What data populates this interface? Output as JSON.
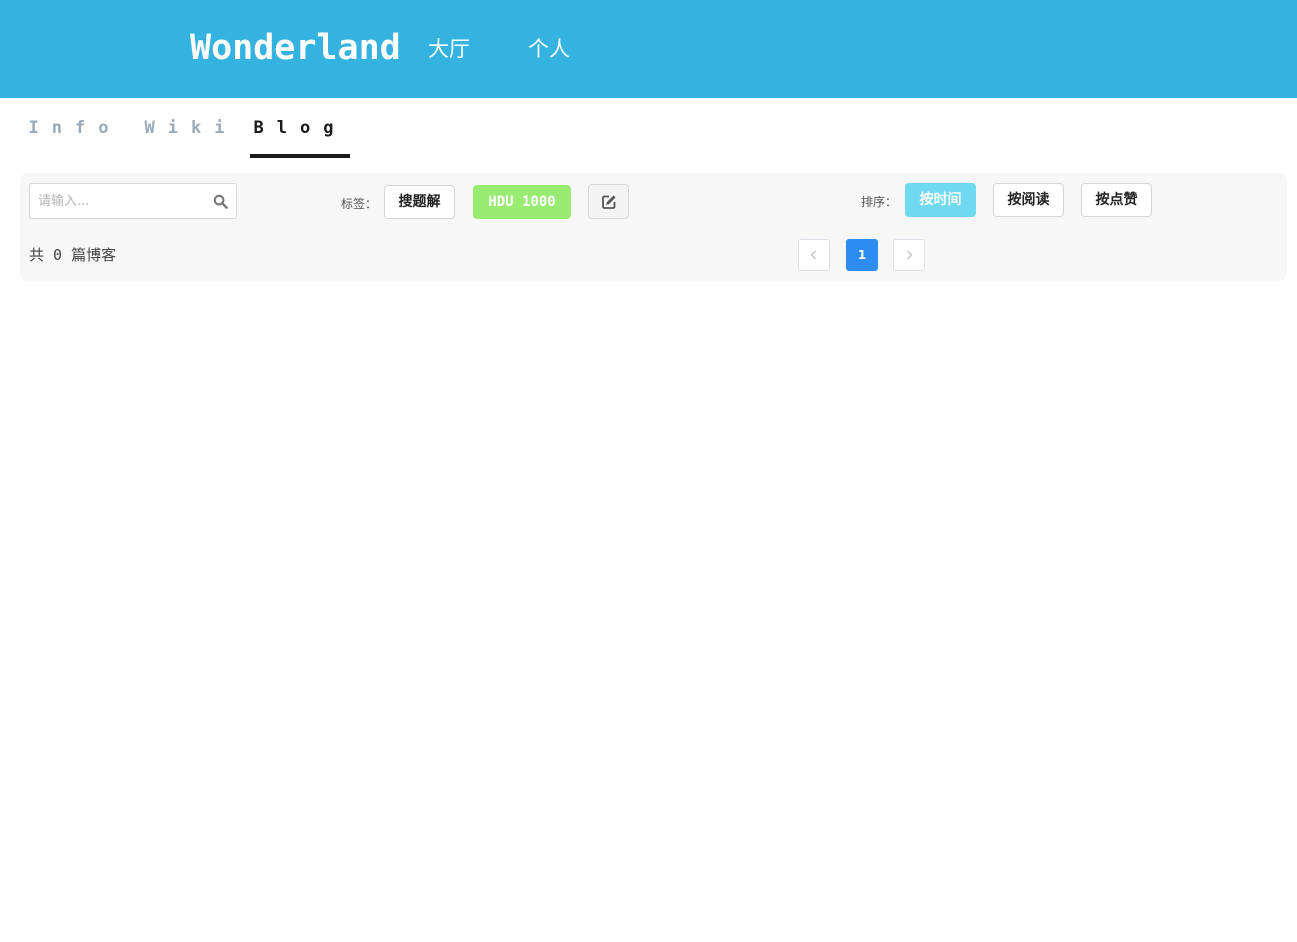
{
  "header": {
    "brand": "Wonderland",
    "nav": [
      {
        "label": "大厅"
      },
      {
        "label": "个人"
      }
    ],
    "background_color": "#35b3e0"
  },
  "tabs": [
    {
      "label": "Info",
      "active": false
    },
    {
      "label": "Wiki",
      "active": false
    },
    {
      "label": "Blog",
      "active": true
    }
  ],
  "toolbar": {
    "search": {
      "placeholder": "请输入...",
      "value": "",
      "icon": "search-icon"
    },
    "tags_label": "标签：",
    "tags": [
      {
        "label": "搜题解",
        "selected": false
      },
      {
        "label": "HDU 1000",
        "selected": true,
        "color": "#98ec72"
      }
    ],
    "edit_icon": "edit-icon",
    "sort_label": "排序：",
    "sort_options": [
      {
        "label": "按时间",
        "selected": true,
        "color": "#6fd9ef"
      },
      {
        "label": "按阅读",
        "selected": false
      },
      {
        "label": "按点赞",
        "selected": false
      }
    ]
  },
  "summary": {
    "text": "共 0 篇博客"
  },
  "pagination": {
    "prev_icon": "chevron-left-icon",
    "current_page": "1",
    "next_icon": "chevron-right-icon",
    "active_color": "#2d8cf0"
  }
}
